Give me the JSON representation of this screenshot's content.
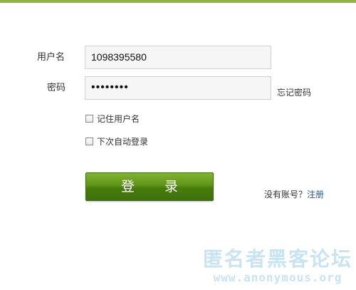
{
  "form": {
    "username_label": "用户名",
    "username_value": "1098395580",
    "password_label": "密码",
    "password_value": "••••••••",
    "forgot_password": "忘记密码",
    "remember_username": "记住用户名",
    "auto_login": "下次自动登录",
    "login_button": "登 录",
    "no_account_text": "没有账号？",
    "register_link": "注册"
  },
  "watermark": {
    "chinese": "匿名者黑客论坛",
    "url": "www.anonymous.org"
  },
  "colors": {
    "top_bar": "#8cb63c",
    "button_green": "#4f8a10",
    "link_blue": "#1f5ea8"
  }
}
